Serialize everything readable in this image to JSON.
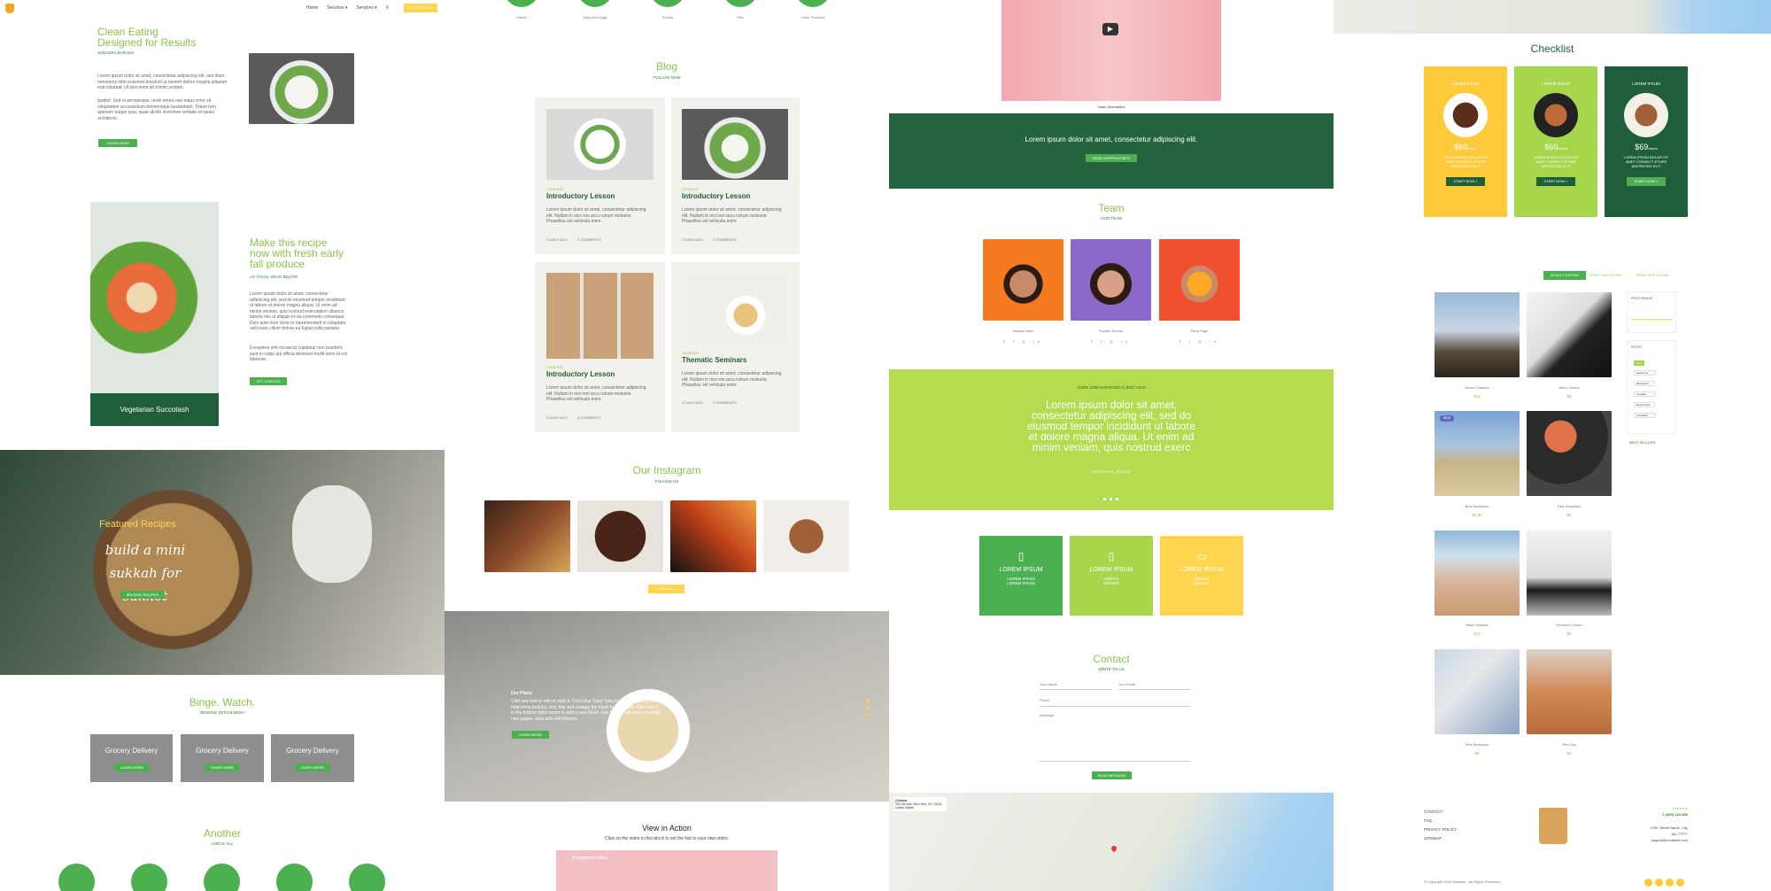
{
  "header": {
    "nav": [
      "Home",
      "Services ▾",
      "Services ▾"
    ],
    "cta": "GET IN TOUCH"
  },
  "clean": {
    "title1": "Clean Eating",
    "title2": "Designed for Results",
    "sub": "SUBADRA BVRAKS",
    "p1": "Lorem ipsum dolor sit amet, consectetur adipiscing elit, sed diam nonummy nibh euismod tincidunt ut laoreet dolore magna aliquam erat volutpat. Ut wisi enim ad minim veniam.",
    "p2": "Ipsdiof. Sed ut perspiciatis, unde omnis iste natus error sit voluptatem accusantium doloremque laudantium. Totam rem aperiam eaque ipsa, quae ab illo inventore veritatis et quasi architecto.",
    "btn": "LEARN MORE"
  },
  "recipe": {
    "title": "Make this recipe now with fresh early fall produce",
    "sub": "AS YOU'LL READ BELOW",
    "p1": "Lorem ipsum dolor sit amet, consectetur adipiscing elit, sed do eiusmod tempor incididunt ut labore et dolore magna aliqua. Ut enim ad minim veniam, quis nostrud exercitation ullamco laboris nisi ut aliquip ex ea commodo consequat. Duis aute irure dolor in reprehenderit in voluptate velit esse cillum dolore eu fugiat nulla pariatur.",
    "p2": "Excepteur sint occaecat cupidatat non proident, sunt in culpa qui officia deserunt mollit anim id est laborum.",
    "btn": "GET STARTED",
    "card": "Vegetarian Succotash"
  },
  "featured": {
    "title": "Featured Recipes",
    "script": "build a mini sukkah for sukkot",
    "btn": "BROWSE RECIPES"
  },
  "binge": {
    "title": "Binge. Watch.",
    "sub": "BINGING WITH BABISH",
    "cards": [
      {
        "label": "Grocery Delivery",
        "btn": "LEARN MORE"
      },
      {
        "label": "Grocery Delivery",
        "btn": "LEARN MORE"
      },
      {
        "label": "Grocery Delivery",
        "btn": "LEARN MORE"
      }
    ]
  },
  "another": {
    "title": "Another",
    "sub": "CHECK ALL"
  },
  "cats": [
    "Pantry",
    "Dairy And Eggs",
    "Poultry",
    "Fish",
    "Other Products"
  ],
  "blog": {
    "title": "Blog",
    "sub": "FOLLOW NOW",
    "posts": [
      {
        "cat": "COOKING",
        "title": "Introductory Lesson",
        "text": "Lorem ipsum dolor sit amet, consectetur adipiscing elit. Nullam in nisi non arcu rutrum molestie. Phasellus vel vehicula enim.",
        "d": "3 DAYS AGO",
        "c": "3 COMMENTS"
      },
      {
        "cat": "COOKING",
        "title": "Introductory Lesson",
        "text": "Lorem ipsum dolor sit amet, consectetur adipiscing elit. Nullam in nisi non arcu rutrum molestie. Phasellus vel vehicula enim.",
        "d": "3 DAYS AGO",
        "c": "3 COMMENTS"
      },
      {
        "cat": "COOKING",
        "title": "Introductory Lesson",
        "text": "Lorem ipsum dolor sit amet, consectetur adipiscing elit. Nullam in nisi non arcu rutrum molestie. Phasellus vel vehicula enim.",
        "d": "3 DAYS AGO",
        "c": "3 COMMENTS"
      },
      {
        "cat": "COOKING",
        "title": "Thematic Seminars",
        "text": "Lorem ipsum dolor sit amet, consectetur adipiscing elit. Nullam in nisi non arcu rutrum molestie. Phasellus vel vehicula enim.",
        "d": "3 DAYS AGO",
        "c": "3 COMMENTS"
      }
    ]
  },
  "insta": {
    "title": "Our Instagram",
    "sub": "FOLLOW US",
    "btn": "VIEW ALL"
  },
  "hero2": {
    "title": "Our Plans",
    "text": "Click any text to edit or style it. Click blue 'Gear' icon in the top right corner to hide/show buttons, text, title and change the block background. Click red '+' in the bottom right corner to add a new block. Use the top left menu to create new pages, sites and add themes.",
    "btn": "LEARN MORE"
  },
  "video": {
    "title": "View in Action",
    "sub": "Click on the video in this block to set the link to your own video.",
    "label": "Background video",
    "caption": "Video Description"
  },
  "banner": {
    "text": "Lorem ipsum dolor sit amet, consectetur adipiscing elit.",
    "btn": "READ SHIPPING INFO"
  },
  "team": {
    "title": "Team",
    "sub": "OUR TEAM",
    "members": [
      {
        "name": "Edward Nash"
      },
      {
        "name": "Phoebe Fenton"
      },
      {
        "name": "Perry Page"
      }
    ]
  },
  "quote": {
    "eyebrow": "OVER 1000 SATISFIED CLIENT KIDS",
    "text": "Lorem ipsum dolor sit amet, consectetur adipiscing elit, sed do eiusmod tempor incididunt ut labore et dolore magna aliqua. Ut enim ad minim veniam, quis nostrud exerc",
    "author": "Amelia Scott, Manager"
  },
  "features": [
    {
      "title": "LOREM IPSUM",
      "text": "LOREM IPSUM LOREM IPSUM",
      "color": "#4caf50"
    },
    {
      "title": "LOREM IPSUM",
      "text": "SIMPLE DESIGN",
      "color": "#a5d64c"
    },
    {
      "title": "LOREM IPSUM",
      "text": "SIMPLE DESIGN",
      "color": "#ffd54f"
    }
  ],
  "contact": {
    "title": "Contact",
    "sub": "WRITE TO US",
    "name": "Your Name",
    "email": "Your Email",
    "phone": "Phone",
    "message": "Message",
    "btn": "SEND MESSAGE"
  },
  "map": {
    "place": "Chelsea",
    "addr": "350 5th Ave, New York, NY 10118, United States"
  },
  "checklist": {
    "title": "Checklist",
    "plans": [
      {
        "name": "LOREM IPSUM",
        "price": "$69",
        "per": "/week",
        "text": "LOREM IPSUM DOLOR SIT AMET CONSECT ETUER ADIPISCING ELIT",
        "btn": "START NOW »",
        "color": "#ffc93c"
      },
      {
        "name": "LOREM IPSUM",
        "price": "$69",
        "per": "/week",
        "text": "LOREM IPSUM DOLOR SIT AMET CONSECT ETUER ADIPISCING ELIT",
        "btn": "START NOW »",
        "color": "#a5d64c"
      },
      {
        "name": "LOREM IPSUM",
        "price": "$69",
        "per": "/week",
        "text": "LOREM IPSUM DOLOR SIT AMET CONSECT ETUER ADIPISCING ELIT",
        "btn": "START NOW »",
        "color": "#1e5e3a"
      }
    ]
  },
  "shop": {
    "sort": [
      "DEFAULT SORTING",
      "PRICE: LOW TO HIGH",
      "PRICE: HIGH TO LOW"
    ],
    "price_range": "PRICE RANGE",
    "filter": "FILTER",
    "filters": [
      "ALL",
      "Awesome",
      "Wonderful",
      "Creative",
      "Responsive",
      "Animated"
    ],
    "best": "BEST SELLERS",
    "products": [
      {
        "name": "Brown Glasses",
        "price": "$12"
      },
      {
        "name": "Men's Shoes",
        "price": "$9"
      },
      {
        "name": "Blue Backpack",
        "price": "$8 $6",
        "badge": "NEW"
      },
      {
        "name": "Red Snapback",
        "price": "$8"
      },
      {
        "name": "Black Glasses",
        "price": "$12"
      },
      {
        "name": "Women's Shoes",
        "price": "$9"
      },
      {
        "name": "Pink Backpack",
        "price": "$8"
      },
      {
        "name": "Red Cap",
        "price": "$9"
      }
    ]
  },
  "footer": {
    "links": [
      "CONTACT",
      "FAQ",
      "PRIVACY POLICY",
      "SITEMAP"
    ],
    "callus": "Call Us at",
    "phone": "1 (800) 123-456",
    "addr1": "1234, Street Name, City",
    "addr2": "AA, 77777",
    "email": "support@mobirise.com",
    "copy": "© Copyright 2020 Mobirise - All Rights Reserved"
  }
}
